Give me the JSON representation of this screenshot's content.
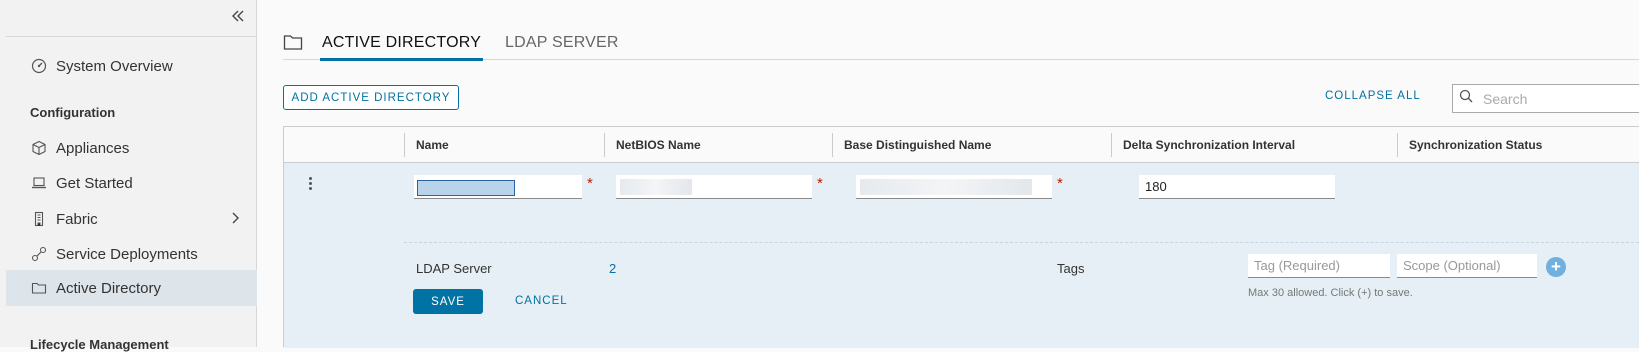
{
  "sidebar": {
    "collapse_icon": "double-chevron-left-icon",
    "items": [
      {
        "label": "System Overview",
        "icon": "dashboard-gauge-icon"
      },
      {
        "label": "Appliances",
        "icon": "cube-icon"
      },
      {
        "label": "Get Started",
        "icon": "laptop-icon"
      },
      {
        "label": "Fabric",
        "icon": "building-icon"
      },
      {
        "label": "Service Deployments",
        "icon": "network-link-icon"
      },
      {
        "label": "Active Directory",
        "icon": "folder-icon"
      }
    ],
    "section_configuration": "Configuration",
    "section_lifecycle": "Lifecycle Management",
    "active_item": "Active Directory"
  },
  "tabs": [
    {
      "label": "ACTIVE DIRECTORY",
      "active": true
    },
    {
      "label": "LDAP SERVER",
      "active": false
    }
  ],
  "toolbar": {
    "add_label": "ADD ACTIVE DIRECTORY",
    "collapse_all_label": "COLLAPSE ALL",
    "search_placeholder": "Search"
  },
  "grid": {
    "columns": [
      "Name",
      "NetBIOS Name",
      "Base Distinguished Name",
      "Delta Synchronization Interval",
      "Synchronization Status"
    ],
    "edit_row": {
      "delta_sync_value": "180",
      "ldap_server_label": "LDAP Server",
      "ldap_server_count": "2",
      "tags_label": "Tags",
      "tag_placeholder": "Tag (Required)",
      "scope_placeholder": "Scope (Optional)",
      "tags_hint": "Max 30 allowed. Click (+) to save.",
      "save_label": "SAVE",
      "cancel_label": "CANCEL"
    }
  },
  "colors": {
    "accent": "#0072a3",
    "edit_row_bg": "#e5eff5",
    "required": "#c21d00"
  }
}
